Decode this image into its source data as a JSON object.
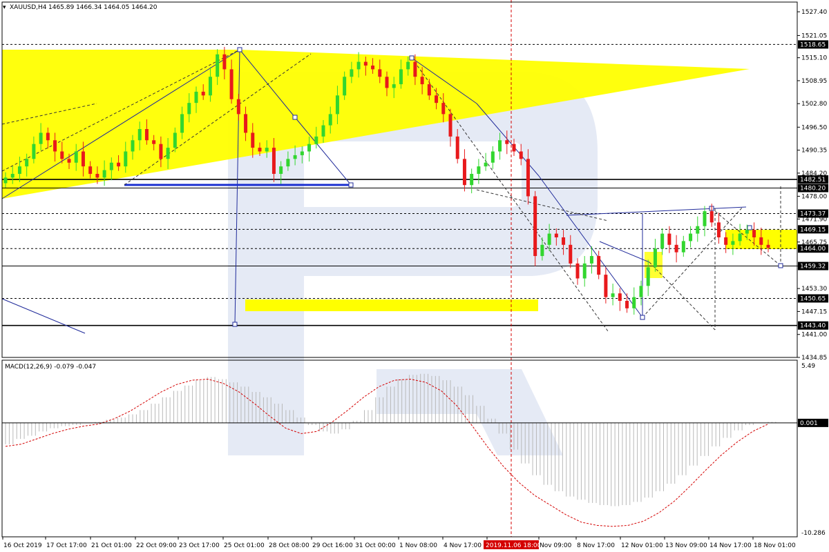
{
  "header": {
    "symbol": "XAUUSD,H4",
    "ohlc": "1465.89 1466.34 1464.05 1464.20"
  },
  "macd_header": "MACD(12,26,9) -0.079 -0.047",
  "highlight_time": "2019.11.06 18:00",
  "colors": {
    "bull": "#32d62f",
    "bear": "#e8191c",
    "yellow": "#ffff00",
    "line_blue": "#1f2a9a",
    "macd_hist": "#b8b8b8",
    "macd_signal": "#d40000",
    "watermark": "#cfd8ec"
  },
  "chart_data": [
    {
      "type": "candlestick",
      "title": "XAUUSD,H4",
      "ylim": [
        1434.85,
        1530.0
      ],
      "price_ticks": [
        "1527.40",
        "1521.05",
        "1515.10",
        "1508.95",
        "1502.80",
        "1496.50",
        "1490.35",
        "1484.20",
        "1478.00",
        "1471.90",
        "1465.75",
        "1459.32",
        "1453.30",
        "1447.15",
        "1441.00",
        "1434.85"
      ],
      "x_labels": [
        "16 Oct 2019",
        "17 Oct 17:00",
        "21 Oct 01:00",
        "22 Oct 09:00",
        "23 Oct 17:00",
        "25 Oct 01:00",
        "28 Oct 08:00",
        "29 Oct 16:00",
        "31 Oct 00:00",
        "1 Nov 08:00",
        "4 Nov 17:00",
        "2019.11.06 18:00",
        "Nov 09:00",
        "8 Nov 17:00",
        "12 Nov 01:00",
        "13 Nov 09:00",
        "14 Nov 17:00",
        "18 Nov 01:00"
      ],
      "levels": [
        {
          "price": 1518.65,
          "label": "1518.65",
          "style": "dashed"
        },
        {
          "price": 1482.51,
          "label": "1482.51",
          "style": "solid-bold"
        },
        {
          "price": 1480.2,
          "label": "1480.20",
          "style": "solid"
        },
        {
          "price": 1473.37,
          "label": "1473.37",
          "style": "dashed"
        },
        {
          "price": 1469.15,
          "label": "1469.15",
          "style": "dashed"
        },
        {
          "price": 1464.0,
          "label": "1464.00",
          "style": "dashed"
        },
        {
          "price": 1459.32,
          "label": "1459.32",
          "style": "solid"
        },
        {
          "price": 1450.65,
          "label": "1450.65",
          "style": "dashed"
        },
        {
          "price": 1443.4,
          "label": "1443.40",
          "style": "solid-bold"
        }
      ],
      "close_path": [
        1483,
        1484,
        1486,
        1488,
        1492,
        1495,
        1493,
        1490,
        1488,
        1487,
        1490,
        1486,
        1484,
        1483,
        1485,
        1487,
        1486,
        1490,
        1493,
        1496,
        1493,
        1492,
        1488,
        1491,
        1495,
        1500,
        1503,
        1506,
        1505,
        1510,
        1516,
        1512,
        1504,
        1500,
        1495,
        1491,
        1490,
        1491,
        1484,
        1486,
        1488,
        1489,
        1490,
        1492,
        1494,
        1497,
        1500,
        1505,
        1510,
        1512,
        1514,
        1513,
        1512,
        1510,
        1507,
        1508,
        1512,
        1514,
        1510,
        1508,
        1505,
        1503,
        1500,
        1494,
        1488,
        1481,
        1484,
        1486,
        1487,
        1490,
        1493,
        1492,
        1490,
        1488,
        1478,
        1462,
        1465,
        1468,
        1467,
        1465,
        1460,
        1456,
        1460,
        1462,
        1457,
        1451,
        1452,
        1450,
        1448,
        1451,
        1454,
        1459,
        1464,
        1468,
        1465,
        1463,
        1466,
        1468,
        1470,
        1474,
        1471,
        1467,
        1465,
        1466,
        1468,
        1469,
        1467,
        1465,
        1464.2
      ]
    },
    {
      "type": "bar",
      "title": "MACD(12,26,9) -0.079 -0.047",
      "ylim": [
        -10.286,
        5.49
      ],
      "y_ticks": [
        "5.49",
        "0.001",
        "-10.286"
      ],
      "macd_path": [
        -2,
        -1.5,
        -1.2,
        -0.8,
        -0.5,
        -0.3,
        -0.2,
        0,
        0.1,
        0.3,
        0.5,
        0.8,
        1.2,
        1.8,
        2.4,
        3.0,
        3.5,
        4.0,
        4.3,
        4.1,
        3.8,
        3.4,
        2.9,
        2.4,
        1.8,
        1.2,
        0.5,
        -0.2,
        -0.8,
        -1.0,
        -0.6,
        0.2,
        1.2,
        2.4,
        3.4,
        4.1,
        4.5,
        4.6,
        4.4,
        4.0,
        3.4,
        2.6,
        1.6,
        0.4,
        -1.0,
        -2.5,
        -3.8,
        -4.9,
        -5.8,
        -6.4,
        -6.9,
        -7.2,
        -7.5,
        -7.7,
        -7.8,
        -7.7,
        -7.4,
        -7.0,
        -6.4,
        -5.7,
        -4.9,
        -4.0,
        -3.1,
        -2.2,
        -1.4,
        -0.7,
        -0.2,
        0,
        0.1
      ],
      "signal_path": [
        -2.2,
        -2.0,
        -1.5,
        -1.0,
        -0.6,
        -0.3,
        -0.1,
        0.4,
        1.1,
        2.0,
        2.9,
        3.6,
        4.0,
        4.1,
        3.7,
        2.9,
        1.8,
        0.6,
        -0.5,
        -1.0,
        -0.8,
        0.1,
        1.2,
        2.4,
        3.4,
        4.0,
        4.1,
        3.8,
        3.0,
        1.6,
        -0.3,
        -2.3,
        -4.1,
        -5.6,
        -6.8,
        -7.7,
        -8.6,
        -9.3,
        -9.6,
        -9.7,
        -9.6,
        -9.2,
        -8.4,
        -7.3,
        -5.9,
        -4.4,
        -3.0,
        -1.8,
        -0.8,
        -0.1
      ]
    }
  ]
}
